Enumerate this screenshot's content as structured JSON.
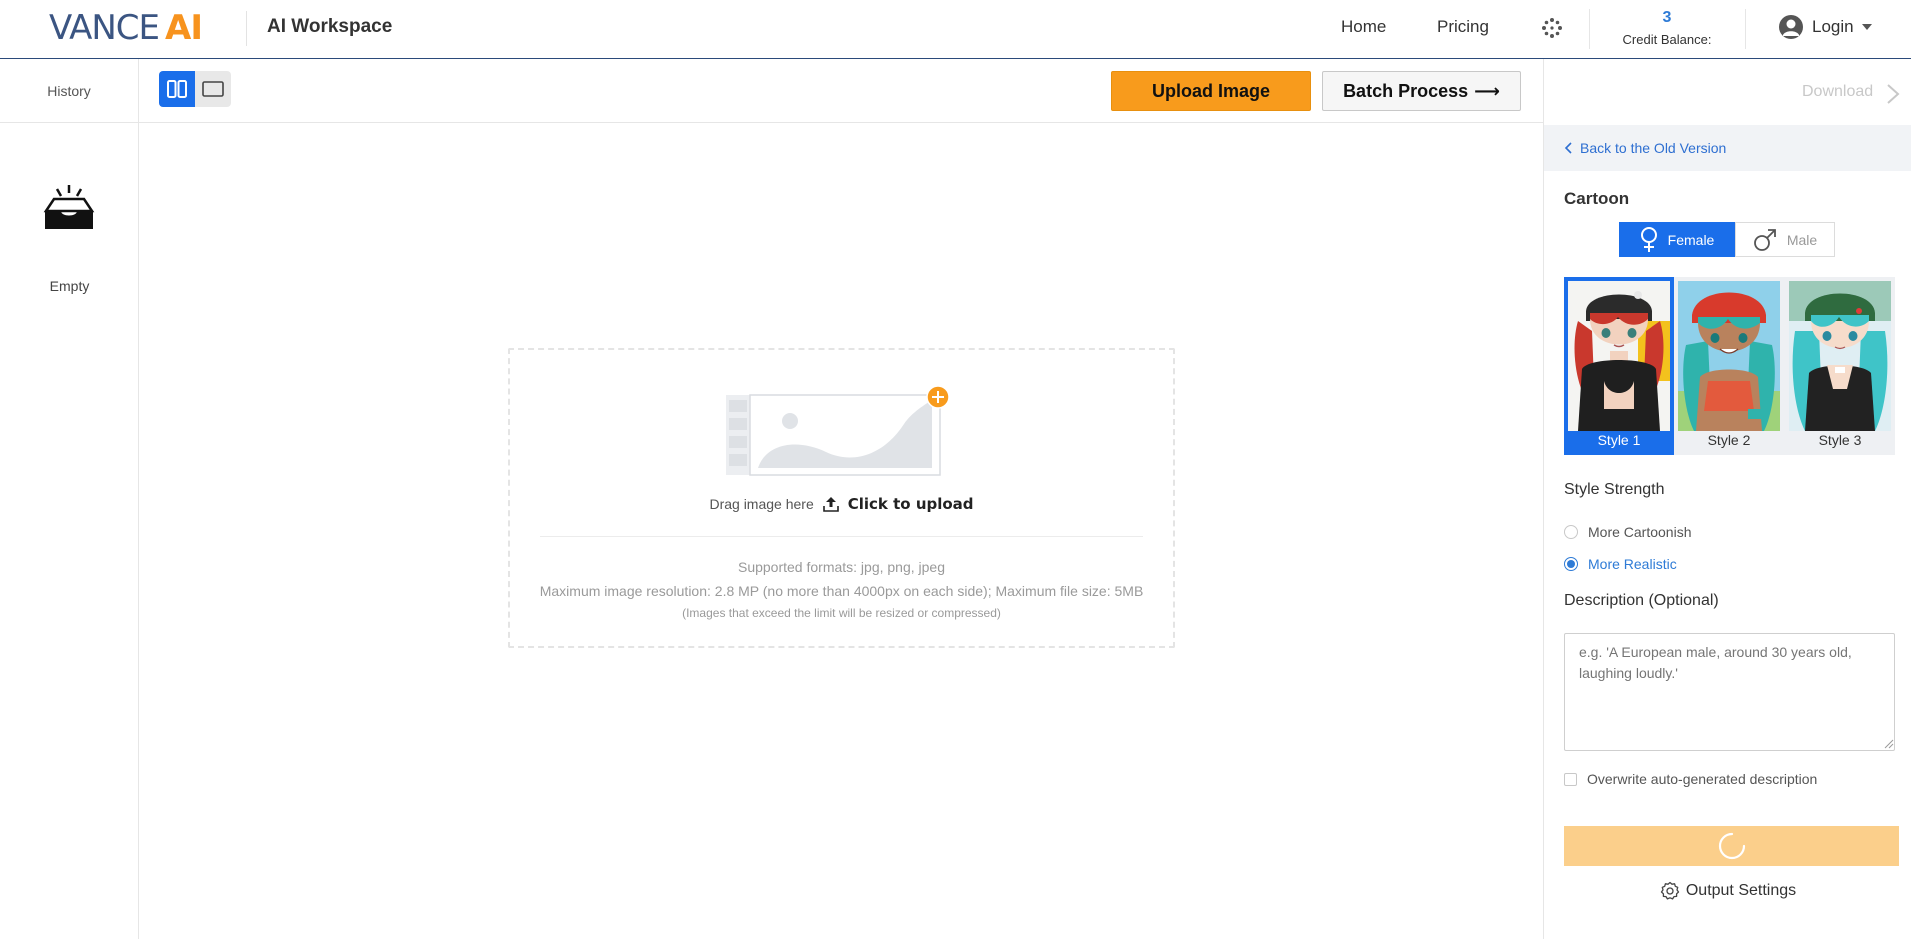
{
  "header": {
    "logo_vance": "VANCE",
    "logo_ai": "AI",
    "workspace_title": "AI Workspace",
    "nav": {
      "home": "Home",
      "pricing": "Pricing"
    },
    "credit_count": "3",
    "credit_label": "Credit Balance:",
    "login_label": "Login"
  },
  "sidebar": {
    "history_label": "History",
    "empty_label": "Empty"
  },
  "toolbar": {
    "upload_label": "Upload Image",
    "batch_label": "Batch Process",
    "batch_arrow": "⟶"
  },
  "dropzone": {
    "drag_text": "Drag image here",
    "click_text": "Click to upload",
    "formats": "Supported formats: jpg, png, jpeg",
    "resolution": "Maximum image resolution: 2.8 MP (no more than 4000px on each side); Maximum file size: 5MB",
    "note": "(Images that exceed the limit will be resized or compressed)"
  },
  "panel": {
    "download_label": "Download",
    "back_label": "Back to the Old Version",
    "section_title": "Cartoon",
    "gender": {
      "female": "Female",
      "male": "Male",
      "selected": "Female"
    },
    "styles": [
      {
        "label": "Style 1",
        "selected": true
      },
      {
        "label": "Style 2",
        "selected": false
      },
      {
        "label": "Style 3",
        "selected": false
      }
    ],
    "strength_title": "Style Strength",
    "strength_options": [
      {
        "label": "More Cartoonish",
        "selected": false
      },
      {
        "label": "More Realistic",
        "selected": true
      }
    ],
    "description_title": "Description (Optional)",
    "description_placeholder": "e.g. 'A European male, around 30 years old, laughing loudly.'",
    "description_value": "",
    "overwrite_label": "Overwrite auto-generated description",
    "overwrite_checked": false,
    "output_settings_label": "Output Settings"
  },
  "colors": {
    "brand_blue": "#1a6eea",
    "brand_orange": "#f89b1c",
    "generate_disabled": "#fbcf8b",
    "link_blue": "#2e6fd1"
  }
}
